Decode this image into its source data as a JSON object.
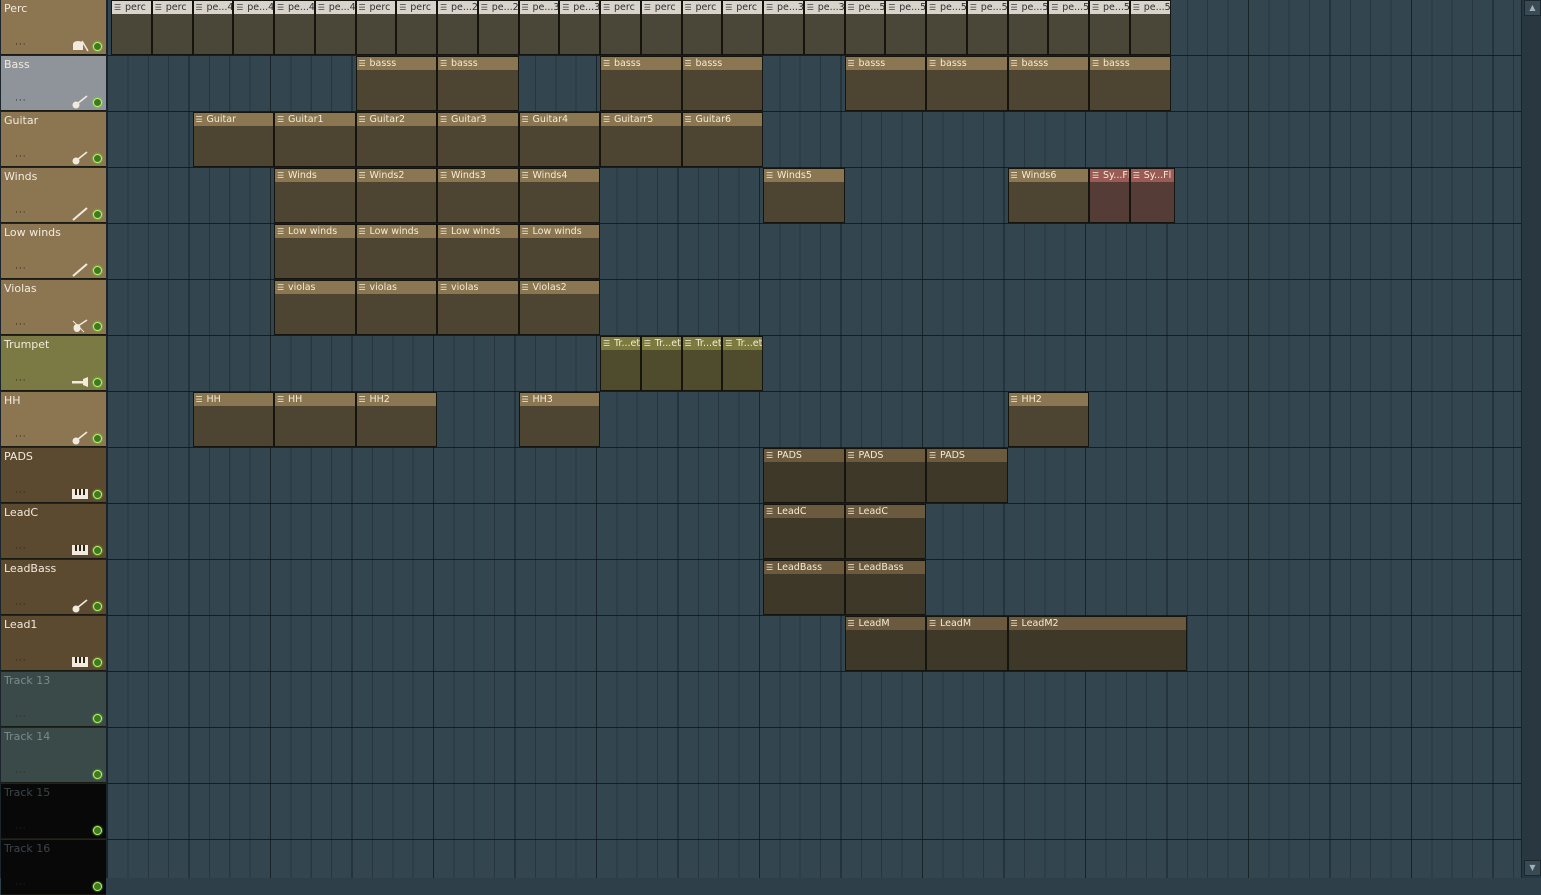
{
  "tracks": [
    {
      "name": "Perc",
      "color": "#8c7652",
      "icon": "drum-icon",
      "muted": false
    },
    {
      "name": "Bass",
      "color": "#8f949a",
      "icon": "guitar-icon",
      "muted": false
    },
    {
      "name": "Guitar",
      "color": "#8c7652",
      "icon": "guitar-icon",
      "muted": false
    },
    {
      "name": "Winds",
      "color": "#8c7652",
      "icon": "flute-icon",
      "muted": false
    },
    {
      "name": "Low winds",
      "color": "#8c7652",
      "icon": "flute-icon",
      "muted": false
    },
    {
      "name": "Violas",
      "color": "#8c7652",
      "icon": "violin-icon",
      "muted": false
    },
    {
      "name": "Trumpet",
      "color": "#7c7a44",
      "icon": "trumpet-icon",
      "muted": false
    },
    {
      "name": "HH",
      "color": "#8c7652",
      "icon": "guitar-icon",
      "muted": false
    },
    {
      "name": "PADS",
      "color": "#5c4a30",
      "icon": "keyboard-icon",
      "muted": false
    },
    {
      "name": "LeadC",
      "color": "#5c4a30",
      "icon": "keyboard-icon",
      "muted": false
    },
    {
      "name": "LeadBass",
      "color": "#5c4a30",
      "icon": "guitar-icon",
      "muted": false
    },
    {
      "name": "Lead1",
      "color": "#5c4a30",
      "icon": "keyboard-icon",
      "muted": false
    },
    {
      "name": "Track 13",
      "color": "#3a4a48",
      "icon": "",
      "muted": true
    },
    {
      "name": "Track 14",
      "color": "#3a4a48",
      "icon": "",
      "muted": true
    },
    {
      "name": "Track 15",
      "color": "#080808",
      "icon": "",
      "muted": true
    },
    {
      "name": "Track 16",
      "color": "#080808",
      "icon": "",
      "muted": true
    }
  ],
  "clips": [
    {
      "track": 0,
      "bar": 0,
      "len": 0.5,
      "label": "perc",
      "style": "lt",
      "notes": "dense"
    },
    {
      "track": 0,
      "bar": 0.5,
      "len": 0.5,
      "label": "perc",
      "style": "lt",
      "notes": "dense"
    },
    {
      "track": 0,
      "bar": 1,
      "len": 0.5,
      "label": "pe...4",
      "style": "lt",
      "notes": "dense"
    },
    {
      "track": 0,
      "bar": 1.5,
      "len": 0.5,
      "label": "pe...4",
      "style": "lt",
      "notes": "dense"
    },
    {
      "track": 0,
      "bar": 2,
      "len": 0.5,
      "label": "pe...4",
      "style": "lt",
      "notes": "dense"
    },
    {
      "track": 0,
      "bar": 2.5,
      "len": 0.5,
      "label": "pe...4",
      "style": "lt",
      "notes": "dense"
    },
    {
      "track": 0,
      "bar": 3,
      "len": 0.5,
      "label": "perc",
      "style": "lt",
      "notes": "dense"
    },
    {
      "track": 0,
      "bar": 3.5,
      "len": 0.5,
      "label": "perc",
      "style": "lt",
      "notes": "dense"
    },
    {
      "track": 0,
      "bar": 4,
      "len": 0.5,
      "label": "pe...2",
      "style": "lt",
      "notes": "tiny"
    },
    {
      "track": 0,
      "bar": 4.5,
      "len": 0.5,
      "label": "pe...2",
      "style": "lt",
      "notes": "tiny"
    },
    {
      "track": 0,
      "bar": 5,
      "len": 0.5,
      "label": "pe...3",
      "style": "lt",
      "notes": "tiny"
    },
    {
      "track": 0,
      "bar": 5.5,
      "len": 0.5,
      "label": "pe...3",
      "style": "lt",
      "notes": "tiny"
    },
    {
      "track": 0,
      "bar": 6,
      "len": 0.5,
      "label": "perc",
      "style": "lt",
      "notes": "dense"
    },
    {
      "track": 0,
      "bar": 6.5,
      "len": 0.5,
      "label": "perc",
      "style": "lt",
      "notes": "dense"
    },
    {
      "track": 0,
      "bar": 7,
      "len": 0.5,
      "label": "perc",
      "style": "lt",
      "notes": "dense"
    },
    {
      "track": 0,
      "bar": 7.5,
      "len": 0.5,
      "label": "perc",
      "style": "lt",
      "notes": "dense"
    },
    {
      "track": 0,
      "bar": 8,
      "len": 0.5,
      "label": "pe...3",
      "style": "lt",
      "notes": "tiny"
    },
    {
      "track": 0,
      "bar": 8.5,
      "len": 0.5,
      "label": "pe...3",
      "style": "lt",
      "notes": "tiny"
    },
    {
      "track": 0,
      "bar": 9,
      "len": 0.5,
      "label": "pe...5",
      "style": "lt",
      "notes": "tiny"
    },
    {
      "track": 0,
      "bar": 9.5,
      "len": 0.5,
      "label": "pe...5",
      "style": "lt",
      "notes": "tiny"
    },
    {
      "track": 0,
      "bar": 10,
      "len": 0.5,
      "label": "pe...5",
      "style": "lt",
      "notes": "tiny"
    },
    {
      "track": 0,
      "bar": 10.5,
      "len": 0.5,
      "label": "pe...5",
      "style": "lt",
      "notes": "tiny"
    },
    {
      "track": 0,
      "bar": 11,
      "len": 0.5,
      "label": "pe...5",
      "style": "lt",
      "notes": "tiny"
    },
    {
      "track": 0,
      "bar": 11.5,
      "len": 0.5,
      "label": "pe...5",
      "style": "lt",
      "notes": "tiny"
    },
    {
      "track": 0,
      "bar": 12,
      "len": 0.5,
      "label": "pe...5",
      "style": "lt",
      "notes": "tiny"
    },
    {
      "track": 0,
      "bar": 12.5,
      "len": 0.5,
      "label": "pe...5",
      "style": "lt",
      "notes": "tiny"
    },
    {
      "track": 1,
      "bar": 3,
      "len": 1,
      "label": "basss",
      "style": "tan",
      "notes": "bass"
    },
    {
      "track": 1,
      "bar": 4,
      "len": 1,
      "label": "basss",
      "style": "tan",
      "notes": "bass"
    },
    {
      "track": 1,
      "bar": 6,
      "len": 1,
      "label": "basss",
      "style": "tan",
      "notes": "bass"
    },
    {
      "track": 1,
      "bar": 7,
      "len": 1,
      "label": "basss",
      "style": "tan",
      "notes": "bass"
    },
    {
      "track": 1,
      "bar": 9,
      "len": 1,
      "label": "basss",
      "style": "tan",
      "notes": "bass"
    },
    {
      "track": 1,
      "bar": 10,
      "len": 1,
      "label": "basss",
      "style": "tan",
      "notes": "bass"
    },
    {
      "track": 1,
      "bar": 11,
      "len": 1,
      "label": "basss",
      "style": "tan",
      "notes": "bass"
    },
    {
      "track": 1,
      "bar": 12,
      "len": 1,
      "label": "basss",
      "style": "tan",
      "notes": "bass"
    },
    {
      "track": 2,
      "bar": 1,
      "len": 1,
      "label": "Guitar",
      "style": "tan",
      "notes": "notes"
    },
    {
      "track": 2,
      "bar": 2,
      "len": 1,
      "label": "Guitar1",
      "style": "tan",
      "notes": "notes"
    },
    {
      "track": 2,
      "bar": 3,
      "len": 1,
      "label": "Guitar2",
      "style": "tan",
      "notes": "notes"
    },
    {
      "track": 2,
      "bar": 4,
      "len": 1,
      "label": "Guitar3",
      "style": "tan",
      "notes": "notes"
    },
    {
      "track": 2,
      "bar": 5,
      "len": 1,
      "label": "Guitar4",
      "style": "tan",
      "notes": "sparse"
    },
    {
      "track": 2,
      "bar": 6,
      "len": 1,
      "label": "Guitarr5",
      "style": "tan",
      "notes": "sparse"
    },
    {
      "track": 2,
      "bar": 7,
      "len": 1,
      "label": "Guitar6",
      "style": "tan",
      "notes": "sparse"
    },
    {
      "track": 3,
      "bar": 2,
      "len": 1,
      "label": "Winds",
      "style": "tan",
      "notes": "notes"
    },
    {
      "track": 3,
      "bar": 3,
      "len": 1,
      "label": "Winds2",
      "style": "tan",
      "notes": "notes"
    },
    {
      "track": 3,
      "bar": 4,
      "len": 1,
      "label": "Winds3",
      "style": "tan",
      "notes": "notes"
    },
    {
      "track": 3,
      "bar": 5,
      "len": 1,
      "label": "Winds4",
      "style": "tan",
      "notes": "sparse"
    },
    {
      "track": 3,
      "bar": 8,
      "len": 1,
      "label": "Winds5",
      "style": "tan",
      "notes": "notes"
    },
    {
      "track": 3,
      "bar": 11,
      "len": 1,
      "label": "Winds6",
      "style": "tan",
      "notes": "tiny"
    },
    {
      "track": 3,
      "bar": 12,
      "len": 0.5,
      "label": "Sy...Fl",
      "style": "red",
      "notes": "sparse"
    },
    {
      "track": 3,
      "bar": 12.5,
      "len": 0.55,
      "label": "Sy...Fl",
      "style": "red",
      "notes": "sparse"
    },
    {
      "track": 4,
      "bar": 2,
      "len": 1,
      "label": "Low winds",
      "style": "tan",
      "notes": "lines"
    },
    {
      "track": 4,
      "bar": 3,
      "len": 1,
      "label": "Low winds",
      "style": "tan",
      "notes": "lines"
    },
    {
      "track": 4,
      "bar": 4,
      "len": 1,
      "label": "Low winds",
      "style": "tan",
      "notes": "lines"
    },
    {
      "track": 4,
      "bar": 5,
      "len": 1,
      "label": "Low winds",
      "style": "tan",
      "notes": "lines"
    },
    {
      "track": 5,
      "bar": 2,
      "len": 1,
      "label": "violas",
      "style": "tan",
      "notes": "lines"
    },
    {
      "track": 5,
      "bar": 3,
      "len": 1,
      "label": "violas",
      "style": "tan",
      "notes": "lines"
    },
    {
      "track": 5,
      "bar": 4,
      "len": 1,
      "label": "violas",
      "style": "tan",
      "notes": "lines"
    },
    {
      "track": 5,
      "bar": 5,
      "len": 1,
      "label": "Violas2",
      "style": "tan",
      "notes": "lines"
    },
    {
      "track": 6,
      "bar": 6,
      "len": 0.5,
      "label": "Tr...et",
      "style": "olive",
      "notes": "tiny"
    },
    {
      "track": 6,
      "bar": 6.5,
      "len": 0.5,
      "label": "Tr...et",
      "style": "olive",
      "notes": "tiny"
    },
    {
      "track": 6,
      "bar": 7,
      "len": 0.5,
      "label": "Tr...et",
      "style": "olive",
      "notes": "tiny"
    },
    {
      "track": 6,
      "bar": 7.5,
      "len": 0.5,
      "label": "Tr...et",
      "style": "olive",
      "notes": "tiny"
    },
    {
      "track": 7,
      "bar": 1,
      "len": 1,
      "label": "HH",
      "style": "tan",
      "notes": "notes"
    },
    {
      "track": 7,
      "bar": 2,
      "len": 1,
      "label": "HH",
      "style": "tan",
      "notes": "notes"
    },
    {
      "track": 7,
      "bar": 3,
      "len": 1,
      "label": "HH2",
      "style": "tan",
      "notes": "notes"
    },
    {
      "track": 7,
      "bar": 5,
      "len": 1,
      "label": "HH3",
      "style": "tan",
      "notes": "sparse"
    },
    {
      "track": 7,
      "bar": 11,
      "len": 1,
      "label": "HH2",
      "style": "tan",
      "notes": "notes"
    },
    {
      "track": 8,
      "bar": 8,
      "len": 1,
      "label": "PADS",
      "style": "dk",
      "notes": "lines"
    },
    {
      "track": 8,
      "bar": 9,
      "len": 1,
      "label": "PADS",
      "style": "dk",
      "notes": "lines"
    },
    {
      "track": 8,
      "bar": 10,
      "len": 1,
      "label": "PADS",
      "style": "dk",
      "notes": "lines"
    },
    {
      "track": 9,
      "bar": 8,
      "len": 1,
      "label": "LeadC",
      "style": "dk",
      "notes": "tiny"
    },
    {
      "track": 9,
      "bar": 9,
      "len": 1,
      "label": "LeadC",
      "style": "dk",
      "notes": "tiny"
    },
    {
      "track": 10,
      "bar": 8,
      "len": 1,
      "label": "LeadBass",
      "style": "dk",
      "notes": "bass"
    },
    {
      "track": 10,
      "bar": 9,
      "len": 1,
      "label": "LeadBass",
      "style": "dk",
      "notes": "bass"
    },
    {
      "track": 11,
      "bar": 9,
      "len": 1,
      "label": "LeadM",
      "style": "dk",
      "notes": "sparse"
    },
    {
      "track": 11,
      "bar": 10,
      "len": 1,
      "label": "LeadM",
      "style": "dk",
      "notes": "sparse"
    },
    {
      "track": 11,
      "bar": 11,
      "len": 2.2,
      "label": "LeadM2",
      "style": "dk",
      "notes": "notes"
    }
  ],
  "scrollbar": {
    "up": "▲",
    "down": "▼"
  }
}
